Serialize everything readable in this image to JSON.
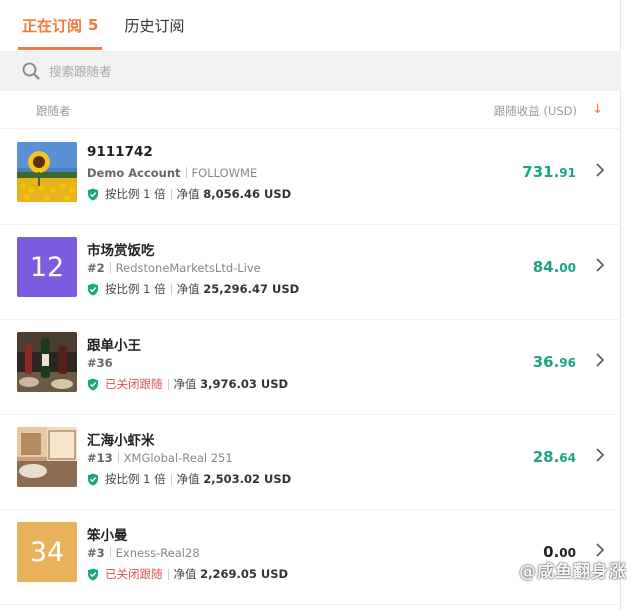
{
  "tabs": {
    "active_label": "正在订阅",
    "active_count": "5",
    "history_label": "历史订阅"
  },
  "search": {
    "placeholder": "搜索跟随者"
  },
  "columns": {
    "follower": "跟随者",
    "profit": "跟随收益 (USD)",
    "sort_arrow": "↓"
  },
  "rows": [
    {
      "name": "9111742",
      "badge": "Demo Account",
      "account": "FOLLOWME",
      "status": "按比例 1 倍",
      "status_closed": false,
      "nv_label": "净值",
      "nv": "8,056.46 USD",
      "profit_int": "731.",
      "profit_dec": "91",
      "avatar_text": ""
    },
    {
      "name": "市场赏饭吃",
      "badge": "#2",
      "account": "RedstoneMarketsLtd-Live",
      "status": "按比例 1 倍",
      "status_closed": false,
      "nv_label": "净值",
      "nv": "25,296.47 USD",
      "profit_int": "84.",
      "profit_dec": "00",
      "avatar_text": "12"
    },
    {
      "name": "跟单小王",
      "badge": "#36",
      "account": "",
      "status": "已关闭跟随",
      "status_closed": true,
      "nv_label": "净值",
      "nv": "3,976.03 USD",
      "profit_int": "36.",
      "profit_dec": "96",
      "avatar_text": ""
    },
    {
      "name": "汇海小虾米",
      "badge": "#13",
      "account": "XMGlobal-Real 251",
      "status": "按比例 1 倍",
      "status_closed": false,
      "nv_label": "净值",
      "nv": "2,503.02 USD",
      "profit_int": "28.",
      "profit_dec": "64",
      "avatar_text": ""
    },
    {
      "name": "笨小曼",
      "badge": "#3",
      "account": "Exness-Real28",
      "status": "已关闭跟随",
      "status_closed": true,
      "nv_label": "净值",
      "nv": "2,269.05 USD",
      "profit_int": "0.",
      "profit_dec": "00",
      "avatar_text": "34"
    }
  ],
  "watermark": "@咸鱼翻身涨",
  "colors": {
    "accent": "#f0793b",
    "profit": "#1aa587",
    "verified": "#1aa587",
    "closed": "#e05252",
    "avatar_purple": "#7b5ce0",
    "avatar_orange": "#e9b25a"
  }
}
